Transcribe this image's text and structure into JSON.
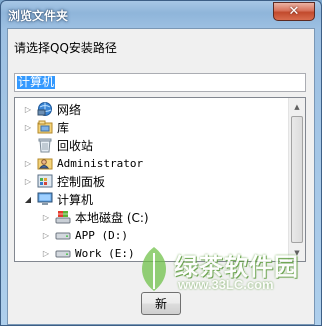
{
  "window": {
    "title": "浏览文件夹",
    "close_glyph": "✕"
  },
  "dialog": {
    "prompt": "请选择QQ安装路径",
    "path_value": "计算机"
  },
  "tree": {
    "items": [
      {
        "label": "网络",
        "icon": "network-icon",
        "expander": "collapsed",
        "indent": 0,
        "mono": false
      },
      {
        "label": "库",
        "icon": "library-icon",
        "expander": "collapsed",
        "indent": 0,
        "mono": false
      },
      {
        "label": "回收站",
        "icon": "recycle-bin-icon",
        "expander": "none",
        "indent": 0,
        "mono": false
      },
      {
        "label": "Administrator",
        "icon": "user-folder-icon",
        "expander": "collapsed",
        "indent": 0,
        "mono": true
      },
      {
        "label": "控制面板",
        "icon": "control-panel-icon",
        "expander": "collapsed",
        "indent": 0,
        "mono": false
      },
      {
        "label": "计算机",
        "icon": "computer-icon",
        "expander": "expanded",
        "indent": 0,
        "mono": false
      },
      {
        "label": "本地磁盘 (C:)",
        "icon": "system-drive-icon",
        "expander": "collapsed",
        "indent": 1,
        "mono": false
      },
      {
        "label": "APP (D:)",
        "icon": "drive-icon",
        "expander": "collapsed",
        "indent": 1,
        "mono": true
      },
      {
        "label": "Work (E:)",
        "icon": "drive-icon",
        "expander": "collapsed",
        "indent": 1,
        "mono": true
      }
    ]
  },
  "buttons": {
    "partial_label": "新"
  },
  "watermark": {
    "brand": "绿茶软件园",
    "url": "www.33LC.com"
  },
  "colors": {
    "selection": "#3399ff",
    "title_bar": "#9dc0e2",
    "close": "#c24a2d"
  }
}
